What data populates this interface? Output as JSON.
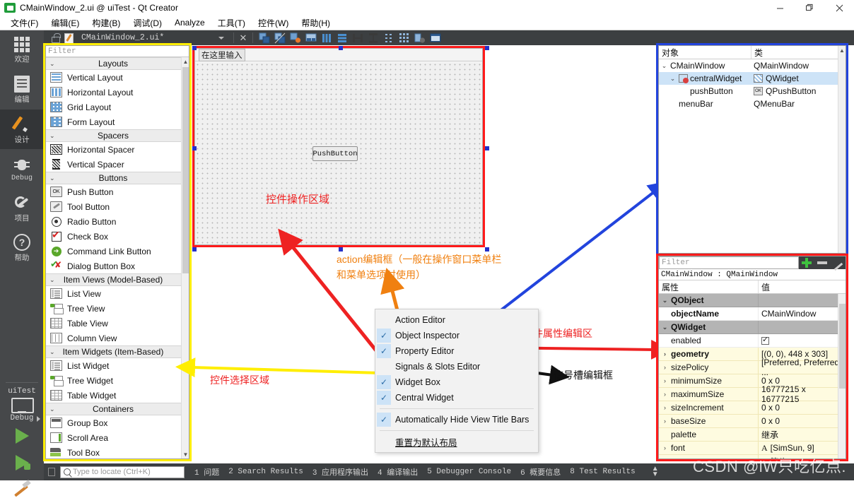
{
  "window": {
    "title": "CMainWindow_2.ui @ uiTest - Qt Creator",
    "minimize": "—",
    "maximize": "❐",
    "close": "✕"
  },
  "menubar": {
    "items": [
      {
        "label": "文件(F)"
      },
      {
        "label": "编辑(E)"
      },
      {
        "label": "构建(B)"
      },
      {
        "label": "调试(D)"
      },
      {
        "label": "Analyze"
      },
      {
        "label": "工具(T)"
      },
      {
        "label": "控件(W)"
      },
      {
        "label": "帮助(H)"
      }
    ]
  },
  "toolbar": {
    "file_name": "CMainWindow_2.ui*",
    "close_label": "✕"
  },
  "modebar": {
    "items": [
      {
        "label": "欢迎",
        "icon": "grid-icon"
      },
      {
        "label": "编辑",
        "icon": "document-icon"
      },
      {
        "label": "设计",
        "icon": "pencil-icon",
        "active": true
      },
      {
        "label": "Debug",
        "icon": "bug-icon"
      },
      {
        "label": "项目",
        "icon": "wrench-icon"
      },
      {
        "label": "帮助",
        "icon": "question-icon"
      }
    ],
    "target_name": "uiTest",
    "target_kind": "Debug"
  },
  "widgetbox": {
    "filter_placeholder": "Filter",
    "groups": [
      {
        "title": "Layouts",
        "items": [
          {
            "label": "Vertical Layout",
            "icon": "vertical-layout-icon"
          },
          {
            "label": "Horizontal Layout",
            "icon": "horizontal-layout-icon"
          },
          {
            "label": "Grid Layout",
            "icon": "grid-layout-icon"
          },
          {
            "label": "Form Layout",
            "icon": "form-layout-icon"
          }
        ]
      },
      {
        "title": "Spacers",
        "items": [
          {
            "label": "Horizontal Spacer",
            "icon": "horizontal-spacer-icon"
          },
          {
            "label": "Vertical Spacer",
            "icon": "vertical-spacer-icon"
          }
        ]
      },
      {
        "title": "Buttons",
        "items": [
          {
            "label": "Push Button",
            "icon": "push-button-icon"
          },
          {
            "label": "Tool Button",
            "icon": "tool-button-icon"
          },
          {
            "label": "Radio Button",
            "icon": "radio-button-icon"
          },
          {
            "label": "Check Box",
            "icon": "check-box-icon"
          },
          {
            "label": "Command Link Button",
            "icon": "command-link-icon"
          },
          {
            "label": "Dialog Button Box",
            "icon": "dialog-button-box-icon"
          }
        ]
      },
      {
        "title": "Item Views (Model-Based)",
        "items": [
          {
            "label": "List View",
            "icon": "list-view-icon"
          },
          {
            "label": "Tree View",
            "icon": "tree-view-icon"
          },
          {
            "label": "Table View",
            "icon": "table-view-icon"
          },
          {
            "label": "Column View",
            "icon": "column-view-icon"
          }
        ]
      },
      {
        "title": "Item Widgets (Item-Based)",
        "items": [
          {
            "label": "List Widget",
            "icon": "list-widget-icon"
          },
          {
            "label": "Tree Widget",
            "icon": "tree-widget-icon"
          },
          {
            "label": "Table Widget",
            "icon": "table-widget-icon"
          }
        ]
      },
      {
        "title": "Containers",
        "items": [
          {
            "label": "Group Box",
            "icon": "group-box-icon"
          },
          {
            "label": "Scroll Area",
            "icon": "scroll-area-icon"
          },
          {
            "label": "Tool Box",
            "icon": "tool-box-icon"
          }
        ]
      }
    ]
  },
  "canvas": {
    "menu_placeholder": "在这里输入",
    "push_button_label": "PushButton",
    "region_label": "控件操作区域"
  },
  "annotations": {
    "action_editor_note": "action编辑框（一般在操作窗口菜单栏\n和菜单选项时使用）",
    "action_editor_note_line1": "action编辑框（一般在操作窗口菜单栏",
    "action_editor_note_line2": "和菜单选项时使用）",
    "widget_select_area": "控件选择区域",
    "property_edit_area": "控件属性编辑区",
    "signal_slot_editor": "信号槽编辑框"
  },
  "context_menu": {
    "items": [
      {
        "label": "Action Editor",
        "checked": false
      },
      {
        "label": "Object Inspector",
        "checked": true
      },
      {
        "label": "Property Editor",
        "checked": true
      },
      {
        "label": "Signals & Slots Editor",
        "checked": false
      },
      {
        "label": "Widget Box",
        "checked": true
      },
      {
        "label": "Central Widget",
        "checked": true
      }
    ],
    "auto_hide": {
      "label": "Automatically Hide View Title Bars",
      "checked": true
    },
    "reset": {
      "label": "重置为默认布局"
    }
  },
  "object_inspector": {
    "columns": [
      "对象",
      "类"
    ],
    "rows": [
      {
        "name": "CMainWindow",
        "class": "QMainWindow",
        "indent": 0,
        "chevron": "⌄",
        "icon": "window-icon",
        "selected": false
      },
      {
        "name": "centralWidget",
        "class": "QWidget",
        "indent": 1,
        "chevron": "⌄",
        "icon": "central-widget-icon",
        "selected": true
      },
      {
        "name": "pushButton",
        "class": "QPushButton",
        "indent": 2,
        "chevron": "",
        "icon": "push-button-icon",
        "selected": false
      },
      {
        "name": "menuBar",
        "class": "QMenuBar",
        "indent": 1,
        "chevron": "",
        "icon": "",
        "selected": false
      }
    ]
  },
  "property_editor": {
    "filter_placeholder": "Filter",
    "object_header": "CMainWindow : QMainWindow",
    "columns": [
      "属性",
      "值"
    ],
    "rows": [
      {
        "name": "QObject",
        "value": "",
        "kind": "group",
        "chevron": "⌄"
      },
      {
        "name": "objectName",
        "value": "CMainWindow",
        "kind": "white",
        "chevron": "",
        "bold": true
      },
      {
        "name": "QWidget",
        "value": "",
        "kind": "group",
        "chevron": "⌄"
      },
      {
        "name": "enabled",
        "value": "",
        "kind": "white",
        "chevron": "",
        "checkbox": true
      },
      {
        "name": "geometry",
        "value": "[(0, 0), 448 x 303]",
        "kind": "val",
        "chevron": "›",
        "bold": true
      },
      {
        "name": "sizePolicy",
        "value": "[Preferred, Preferred, ...",
        "kind": "val",
        "chevron": "›"
      },
      {
        "name": "minimumSize",
        "value": "0 x 0",
        "kind": "val",
        "chevron": "›"
      },
      {
        "name": "maximumSize",
        "value": "16777215 x 16777215",
        "kind": "val",
        "chevron": "›"
      },
      {
        "name": "sizeIncrement",
        "value": "0 x 0",
        "kind": "val",
        "chevron": "›"
      },
      {
        "name": "baseSize",
        "value": "0 x 0",
        "kind": "val",
        "chevron": "›"
      },
      {
        "name": "palette",
        "value": "继承",
        "kind": "val",
        "chevron": ""
      },
      {
        "name": "font",
        "value": "[SimSun, 9]",
        "kind": "val",
        "chevron": "›",
        "prefix": "A"
      },
      {
        "name": "cursor",
        "value": "箭头",
        "kind": "val",
        "chevron": "",
        "prefix": "➤"
      }
    ]
  },
  "statusbar": {
    "locate_placeholder": "Type to locate (Ctrl+K)",
    "items": [
      "1 问题",
      "2 Search Results",
      "3 应用程序输出",
      "4 编译输出",
      "5 Debugger Console",
      "6 概要信息",
      "8 Test Results"
    ]
  },
  "watermark": {
    "text": "CSDN @lW只吃亿点."
  },
  "colors": {
    "accent_red": "#ff1a1a",
    "accent_yellow": "#ffee00",
    "accent_blue": "#2244dd",
    "accent_orange": "#f08010",
    "dark_chrome": "#3c3f41",
    "mode_bar": "#46484a"
  }
}
